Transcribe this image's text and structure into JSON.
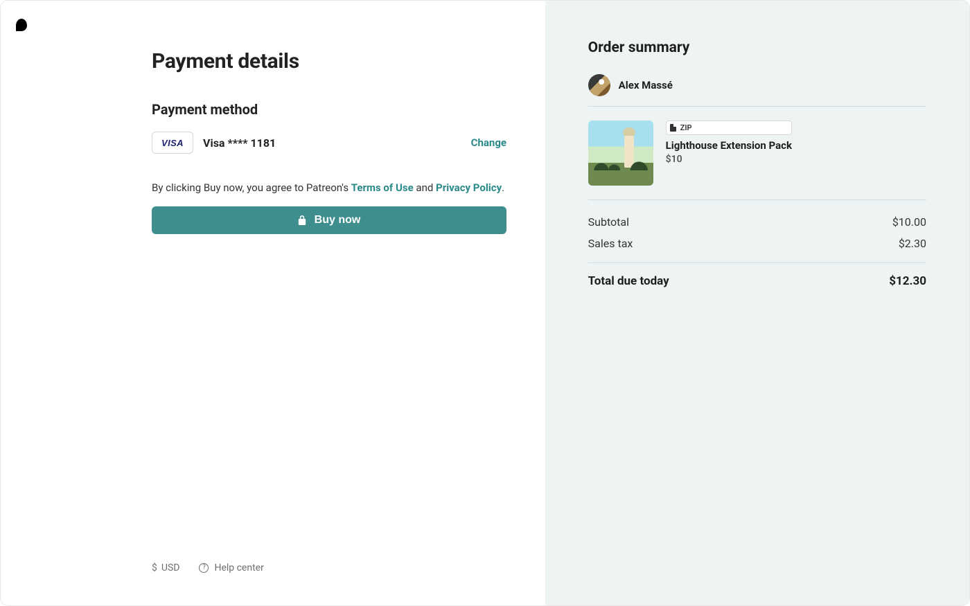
{
  "page_title": "Payment details",
  "payment_method": {
    "section_title": "Payment method",
    "brand": "VISA",
    "description": "Visa **** 1181",
    "change_label": "Change"
  },
  "agreement": {
    "prefix": "By clicking Buy now, you agree to Patreon's ",
    "terms_label": "Terms of Use",
    "joiner": " and ",
    "privacy_label": "Privacy Policy",
    "suffix": "."
  },
  "buy_button_label": "Buy now",
  "footer": {
    "currency_symbol": "$",
    "currency_code": "USD",
    "help_label": "Help center"
  },
  "order_summary": {
    "title": "Order summary",
    "creator_name": "Alex Massé",
    "product": {
      "file_type": "ZIP",
      "name": "Lighthouse Extension Pack",
      "price": "$10"
    },
    "subtotal_label": "Subtotal",
    "subtotal_value": "$10.00",
    "tax_label": "Sales tax",
    "tax_value": "$2.30",
    "total_label": "Total due today",
    "total_value": "$12.30"
  }
}
